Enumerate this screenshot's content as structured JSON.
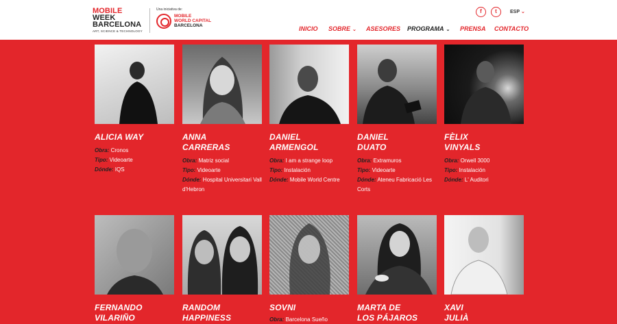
{
  "header": {
    "brand_lines": [
      "MOBILE",
      "WEEK",
      "BARCELONA"
    ],
    "brand_sub": "ART, SCIENCE & TECHNOLOGY",
    "mwc_intro": "Una iniciativa de:",
    "mwc_line1": "MOBILE",
    "mwc_line2": "WORLD CAPITAL",
    "mwc_line3": "BARCELONA",
    "facebook_glyph": "f",
    "twitter_glyph": "t",
    "language": "ESP"
  },
  "nav": {
    "items": [
      {
        "label": "INICIO",
        "has_dropdown": false
      },
      {
        "label": "SOBRE",
        "has_dropdown": true
      },
      {
        "label": "ASESORES",
        "has_dropdown": false
      },
      {
        "label": "PROGRAMA",
        "has_dropdown": true
      },
      {
        "label": "PRENSA",
        "has_dropdown": false
      },
      {
        "label": "CONTACTO",
        "has_dropdown": false
      }
    ]
  },
  "labels": {
    "obra": "Obra:",
    "tipo": "Tipo:",
    "donde": "Dónde:"
  },
  "artists": [
    {
      "name_lines": [
        "ALICIA WAY"
      ],
      "obra": "Cronos",
      "tipo": "Videoarte",
      "donde": "IQS"
    },
    {
      "name_lines": [
        "ANNA",
        "CARRERAS"
      ],
      "obra": "Matriz social",
      "tipo": "Videoarte",
      "donde": "Hospital Universitari Vall d'Hebron"
    },
    {
      "name_lines": [
        "DANIEL",
        "ARMENGOL"
      ],
      "obra": "I am a strange loop",
      "tipo": "Instalación",
      "donde": "Mobile World Centre"
    },
    {
      "name_lines": [
        "DANIEL",
        "DUATO"
      ],
      "obra": "Extramuros",
      "tipo": "Videoarte",
      "donde": "Ateneu Fabricació Les Corts"
    },
    {
      "name_lines": [
        "FÈLIX",
        "VINYALS"
      ],
      "obra": "Orwell 3000",
      "tipo": "Instalación",
      "donde": "L' Auditori"
    },
    {
      "name_lines": [
        "FERNANDO",
        "VILARIÑO"
      ]
    },
    {
      "name_lines": [
        "RANDOM",
        "HAPPINESS"
      ]
    },
    {
      "name_lines": [
        "SOVNI"
      ],
      "obra": "Barcelona Sueño"
    },
    {
      "name_lines": [
        "MARTA DE",
        "LOS PÁJAROS"
      ]
    },
    {
      "name_lines": [
        "XAVI",
        "JULIÀ"
      ]
    }
  ]
}
